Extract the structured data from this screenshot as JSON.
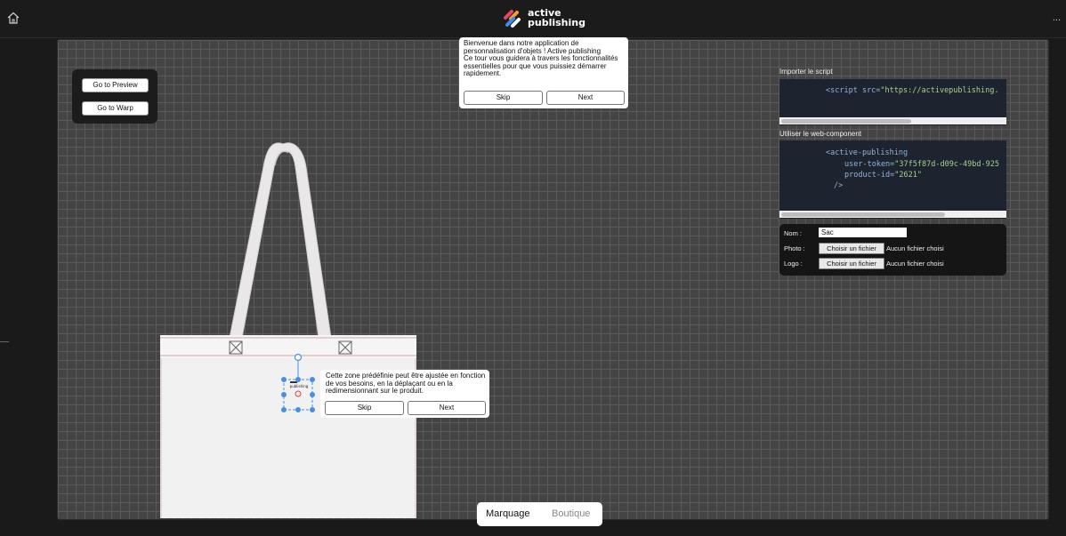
{
  "header": {
    "logo_line1": "active",
    "logo_line2": "publishing",
    "home_icon": "home-icon",
    "more_icon": "more-icon",
    "more_glyph": "..."
  },
  "nav_panel": {
    "preview_label": "Go to Preview",
    "warp_label": "Go to Warp"
  },
  "tour_intro": {
    "text": "Bienvenue dans notre application de personnalisation d'objets ! Active publishing\nCe tour vous guidera à travers les fonctionnalités essentielles pour que vous puissiez démarrer rapidement.",
    "skip_label": "Skip",
    "next_label": "Next"
  },
  "script_section": {
    "label": "Importer le script",
    "code_tag": "<script",
    "code_attr": " src=",
    "code_value": "\"https://activepublishing."
  },
  "component_section": {
    "label": "Utiliser le web-component",
    "line1": "<active-publishing",
    "line2_attr": "user-token=",
    "line2_value": "\"37f5f87d-d09c-49bd-925",
    "line3_attr": "product-id=",
    "line3_value": "\"2621\"",
    "line4": "/>"
  },
  "form": {
    "name_label": "Nom :",
    "name_value": "Sac",
    "photo_label": "Photo :",
    "logo_label": "Logo :",
    "file_button_label": "Choisir un fichier",
    "no_file_text": "Aucun fichier choisi"
  },
  "tour_zone": {
    "text": "Cette zone prédéfinie peut être ajustée en fonction de vos besoins, en la déplaçant ou en la redimensionnant sur le produit.",
    "skip_label": "Skip",
    "next_label": "Next"
  },
  "mode_tabs": {
    "active": "Marquage",
    "inactive": "Boutique"
  },
  "marking_zone": {
    "logo_text": "publishing"
  },
  "colors": {
    "accent_handle": "#4a90e2",
    "canvas_bg": "#444444",
    "code_bg": "#1e2330"
  }
}
